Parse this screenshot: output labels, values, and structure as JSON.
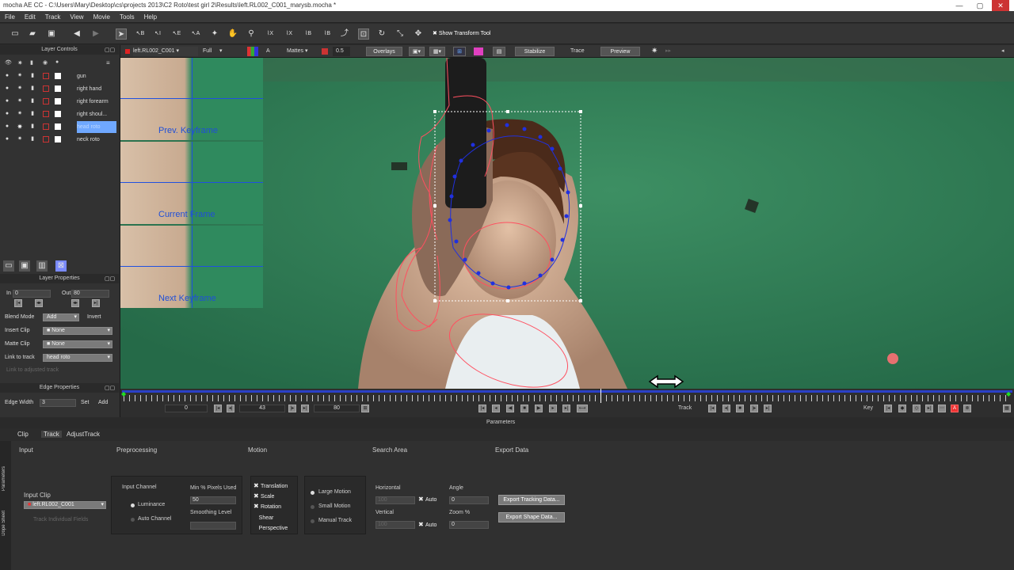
{
  "window": {
    "title": "mocha AE CC - C:\\Users\\Mary\\Desktop\\cs\\projects 2013\\C2 Roto\\test girl 2\\Results\\left.RL002_C001_marysb.mocha *",
    "min": "—",
    "max": "▢",
    "close": "✕"
  },
  "menu": [
    "File",
    "Edit",
    "Track",
    "View",
    "Movie",
    "Tools",
    "Help"
  ],
  "toolbar": {
    "show_transform": "Show Transform Tool",
    "x_label": "X",
    "b_label": "B",
    "i_label": "I",
    "e_label": "E",
    "a_label": "A"
  },
  "viewer_controls": {
    "clip": "left.RL002_C001",
    "res": "Full",
    "matte_a": "A",
    "mattes": "Mattes",
    "opacity": "0.5",
    "overlays": "Overlays",
    "stabilize": "Stabilize",
    "trace": "Trace",
    "preview": "Preview"
  },
  "layer_controls": {
    "title": "Layer Controls",
    "layers": [
      "gun",
      "right hand",
      "right forearm",
      "right shoul...",
      "head roto",
      "neck roto"
    ]
  },
  "layer_properties": {
    "title": "Layer Properties",
    "in_label": "In",
    "in_value": "0",
    "out_label": "Out",
    "out_value": "80",
    "blend_mode_label": "Blend Mode",
    "blend_mode": "Add",
    "invert": "Invert",
    "insert_clip_label": "Insert Clip",
    "insert_clip": "None",
    "matte_clip_label": "Matte Clip",
    "matte_clip": "None",
    "link_label": "Link to track",
    "link_value": "head roto",
    "link_adjusted": "Link to adjusted track"
  },
  "edge_properties": {
    "title": "Edge Properties",
    "width_label": "Edge Width",
    "width_value": "3",
    "set": "Set",
    "add": "Add"
  },
  "keyframe_panels": [
    "Prev. Keyframe",
    "Current Frame",
    "Next Keyframe"
  ],
  "timeline": {
    "start": "0",
    "current": "43",
    "end": "80",
    "track_label": "Track",
    "key_label": "Key",
    "key_a": "A"
  },
  "params_header": "Parameters",
  "tabs": [
    "Clip",
    "Track",
    "AdjustTrack"
  ],
  "side_tabs": [
    "Parameters",
    "Dope Sheet"
  ],
  "sections": {
    "input": "Input",
    "preprocessing": "Preprocessing",
    "motion": "Motion",
    "search_area": "Search Area",
    "export_data": "Export Data"
  },
  "input": {
    "clip_label": "Input Clip",
    "clip_value": "left.RL002_C001",
    "track_individual": "Track Individual Fields"
  },
  "preprocessing": {
    "channel_label": "Input Channel",
    "luminance": "Luminance",
    "auto_channel": "Auto Channel",
    "min_pixels_label": "Min % Pixels Used",
    "min_pixels_value": "50",
    "smoothing_label": "Smoothing Level"
  },
  "motion": {
    "translation": "Translation",
    "scale": "Scale",
    "rotation": "Rotation",
    "shear": "Shear",
    "perspective": "Perspective",
    "large_motion": "Large Motion",
    "small_motion": "Small Motion",
    "manual_track": "Manual Track"
  },
  "search_area": {
    "horizontal": "Horizontal",
    "vertical": "Vertical",
    "h_value": "100",
    "v_value": "100",
    "auto": "Auto",
    "angle": "Angle",
    "angle_value": "0",
    "zoom": "Zoom %",
    "zoom_value": "0"
  },
  "export": {
    "tracking": "Export Tracking Data...",
    "shape": "Export Shape Data..."
  }
}
